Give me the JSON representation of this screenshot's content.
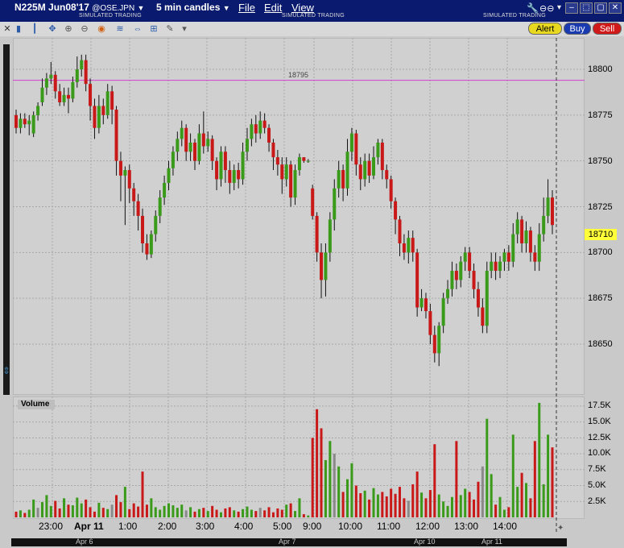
{
  "window": {
    "symbol": "N225M Jun08'17",
    "exchange": "@OSE.JPN",
    "interval": "5 min candles",
    "menu": [
      "File",
      "Edit",
      "View"
    ],
    "simulated_label": "SIMULATED TRADING"
  },
  "toolbar": {
    "alert_label": "Alert",
    "buy_label": "Buy",
    "sell_label": "Sell"
  },
  "colors": {
    "up": "#3a9a1a",
    "down": "#c81818",
    "neutral": "#8a8a8a",
    "hline": "#d040d0",
    "title_bg": "#0a1a6e"
  },
  "price_panel": {
    "current_price": "18710",
    "horizontal_line_label": "18795",
    "price_ticks": [
      "18800",
      "18775",
      "18750",
      "18725",
      "18700",
      "18675",
      "18650"
    ]
  },
  "volume_panel": {
    "title": "Volume",
    "volume_ticks": [
      "17.5K",
      "15.0K",
      "12.5K",
      "10.0K",
      "7.5K",
      "5.0K",
      "2.5K"
    ]
  },
  "time_axis": {
    "labels": [
      "23:00",
      "Apr 11",
      "1:00",
      "2:00",
      "3:00",
      "4:00",
      "5:00",
      "9:00",
      "10:00",
      "11:00",
      "12:00",
      "13:00",
      "14:00"
    ],
    "date_labels": [
      "Apr 6",
      "Apr 7",
      "Apr 10",
      "Apr 11"
    ]
  },
  "chart_data": {
    "type": "candlestick",
    "y_range": [
      18638,
      18815
    ],
    "volume_range": [
      0,
      19000
    ],
    "candles": [
      [
        18775,
        18768,
        18778,
        18765,
        900
      ],
      [
        18768,
        18773,
        18776,
        18765,
        1100
      ],
      [
        18773,
        18770,
        18776,
        18768,
        700
      ],
      [
        18770,
        18772,
        18775,
        18764,
        1200
      ],
      [
        18765,
        18775,
        18777,
        18763,
        2800
      ],
      [
        18775,
        18780,
        18782,
        18772,
        1500
      ],
      [
        18782,
        18790,
        18795,
        18780,
        2400
      ],
      [
        18790,
        18795,
        18798,
        18786,
        3500
      ],
      [
        18795,
        18797,
        18804,
        18792,
        1800
      ],
      [
        18797,
        18788,
        18799,
        18784,
        2600
      ],
      [
        18788,
        18782,
        18792,
        18780,
        1400
      ],
      [
        18782,
        18786,
        18790,
        18780,
        3000
      ],
      [
        18786,
        18784,
        18790,
        18776,
        2000
      ],
      [
        18784,
        18793,
        18796,
        18782,
        1900
      ],
      [
        18793,
        18800,
        18807,
        18790,
        3100
      ],
      [
        18800,
        18805,
        18808,
        18796,
        2200
      ],
      [
        18805,
        18792,
        18808,
        18788,
        2800
      ],
      [
        18792,
        18780,
        18795,
        18772,
        1600
      ],
      [
        18780,
        18768,
        18784,
        18762,
        900
      ],
      [
        18768,
        18780,
        18786,
        18765,
        2300
      ],
      [
        18780,
        18775,
        18784,
        18770,
        1500
      ],
      [
        18775,
        18788,
        18792,
        18773,
        1300
      ],
      [
        18788,
        18778,
        18791,
        18770,
        2000
      ],
      [
        18778,
        18750,
        18780,
        18742,
        3500
      ],
      [
        18750,
        18742,
        18755,
        18728,
        2400
      ],
      [
        18742,
        18745,
        18747,
        18715,
        4800
      ],
      [
        18745,
        18735,
        18748,
        18727,
        1300
      ],
      [
        18735,
        18728,
        18738,
        18720,
        2200
      ],
      [
        18728,
        18720,
        18732,
        18712,
        1700
      ],
      [
        18720,
        18705,
        18724,
        18700,
        7200
      ],
      [
        18705,
        18699,
        18710,
        18696,
        2000
      ],
      [
        18699,
        18710,
        18712,
        18697,
        3000
      ],
      [
        18710,
        18720,
        18723,
        18706,
        1600
      ],
      [
        18720,
        18730,
        18734,
        18716,
        1200
      ],
      [
        18730,
        18738,
        18742,
        18726,
        1800
      ],
      [
        18738,
        18746,
        18750,
        18734,
        2200
      ],
      [
        18746,
        18755,
        18758,
        18742,
        1900
      ],
      [
        18755,
        18762,
        18766,
        18750,
        1500
      ],
      [
        18762,
        18768,
        18772,
        18758,
        2000
      ],
      [
        18768,
        18755,
        18770,
        18750,
        1100
      ],
      [
        18755,
        18760,
        18765,
        18750,
        1600
      ],
      [
        18760,
        18750,
        18762,
        18745,
        900
      ],
      [
        18750,
        18765,
        18770,
        18748,
        1300
      ],
      [
        18765,
        18758,
        18777,
        18754,
        1500
      ],
      [
        18758,
        18762,
        18766,
        18755,
        1000
      ],
      [
        18762,
        18750,
        18764,
        18745,
        1800
      ],
      [
        18750,
        18740,
        18752,
        18734,
        1200
      ],
      [
        18740,
        18755,
        18758,
        18736,
        800
      ],
      [
        18755,
        18745,
        18758,
        18738,
        1400
      ],
      [
        18745,
        18738,
        18750,
        18732,
        1600
      ],
      [
        18738,
        18745,
        18748,
        18734,
        1100
      ],
      [
        18745,
        18740,
        18749,
        18735,
        900
      ],
      [
        18740,
        18755,
        18760,
        18737,
        1300
      ],
      [
        18755,
        18762,
        18768,
        18750,
        1700
      ],
      [
        18762,
        18770,
        18773,
        18758,
        1200
      ],
      [
        18770,
        18765,
        18775,
        18760,
        1000
      ],
      [
        18765,
        18772,
        18777,
        18762,
        1500
      ],
      [
        18772,
        18768,
        18776,
        18765,
        1100
      ],
      [
        18768,
        18760,
        18770,
        18755,
        1600
      ],
      [
        18760,
        18752,
        18762,
        18745,
        800
      ],
      [
        18752,
        18748,
        18756,
        18742,
        1400
      ],
      [
        18748,
        18740,
        18752,
        18732,
        1200
      ],
      [
        18740,
        18748,
        18752,
        18736,
        2000
      ],
      [
        18748,
        18730,
        18750,
        18725,
        2200
      ],
      [
        18730,
        18745,
        18748,
        18726,
        1000
      ],
      [
        18745,
        18752,
        18754,
        18742,
        3000
      ],
      [
        18752,
        18750,
        18752,
        18749,
        500
      ],
      [
        18750,
        18750,
        18751,
        18749,
        300
      ],
      [
        18735,
        18720,
        18737,
        18718,
        12500
      ],
      [
        18720,
        18700,
        18722,
        18695,
        17000
      ],
      [
        18700,
        18685,
        18705,
        18675,
        14000
      ],
      [
        18685,
        18700,
        18705,
        18676,
        9000
      ],
      [
        18700,
        18718,
        18722,
        18695,
        12000
      ],
      [
        18718,
        18735,
        18740,
        18712,
        10000
      ],
      [
        18735,
        18745,
        18750,
        18730,
        8000
      ],
      [
        18745,
        18735,
        18748,
        18728,
        4000
      ],
      [
        18735,
        18755,
        18762,
        18731,
        6000
      ],
      [
        18755,
        18765,
        18768,
        18750,
        8500
      ],
      [
        18765,
        18748,
        18767,
        18742,
        5000
      ],
      [
        18748,
        18740,
        18752,
        18734,
        3800
      ],
      [
        18740,
        18750,
        18754,
        18736,
        4200
      ],
      [
        18750,
        18742,
        18754,
        18738,
        2800
      ],
      [
        18742,
        18752,
        18758,
        18740,
        4600
      ],
      [
        18752,
        18760,
        18762,
        18748,
        3600
      ],
      [
        18760,
        18745,
        18762,
        18740,
        4000
      ],
      [
        18745,
        18740,
        18748,
        18735,
        3300
      ],
      [
        18740,
        18728,
        18742,
        18724,
        4500
      ],
      [
        18728,
        18718,
        18730,
        18710,
        3700
      ],
      [
        18718,
        18705,
        18720,
        18698,
        4800
      ],
      [
        18705,
        18700,
        18710,
        18696,
        3000
      ],
      [
        18700,
        18708,
        18712,
        18694,
        2600
      ],
      [
        18708,
        18700,
        18712,
        18695,
        5200
      ],
      [
        18700,
        18670,
        18702,
        18665,
        7200
      ],
      [
        18670,
        18675,
        18680,
        18668,
        3900
      ],
      [
        18675,
        18668,
        18678,
        18664,
        3000
      ],
      [
        18668,
        18655,
        18672,
        18650,
        4300
      ],
      [
        18655,
        18645,
        18660,
        18640,
        11500
      ],
      [
        18645,
        18660,
        18662,
        18638,
        3600
      ],
      [
        18660,
        18675,
        18678,
        18656,
        2500
      ],
      [
        18675,
        18680,
        18685,
        18672,
        1800
      ],
      [
        18680,
        18690,
        18695,
        18676,
        3200
      ],
      [
        18690,
        18685,
        18694,
        18680,
        12000
      ],
      [
        18685,
        18695,
        18698,
        18681,
        3500
      ],
      [
        18695,
        18700,
        18703,
        18690,
        4500
      ],
      [
        18700,
        18690,
        18703,
        18686,
        4000
      ],
      [
        18690,
        18680,
        18694,
        18675,
        2800
      ],
      [
        18680,
        18670,
        18684,
        18665,
        5600
      ],
      [
        18670,
        18660,
        18675,
        18656,
        8000
      ],
      [
        18660,
        18690,
        18695,
        18656,
        15500
      ],
      [
        18690,
        18695,
        18700,
        18686,
        6800
      ],
      [
        18695,
        18690,
        18700,
        18685,
        2000
      ],
      [
        18690,
        18695,
        18698,
        18686,
        3200
      ],
      [
        18695,
        18700,
        18702,
        18690,
        1200
      ],
      [
        18700,
        18695,
        18704,
        18690,
        1600
      ],
      [
        18695,
        18710,
        18716,
        18692,
        13000
      ],
      [
        18710,
        18718,
        18722,
        18705,
        4800
      ],
      [
        18718,
        18705,
        18720,
        18700,
        7000
      ],
      [
        18705,
        18712,
        18717,
        18700,
        5400
      ],
      [
        18712,
        18700,
        18714,
        18695,
        3000
      ],
      [
        18700,
        18695,
        18704,
        18690,
        12000
      ],
      [
        18695,
        18710,
        18716,
        18690,
        18000
      ],
      [
        18710,
        18720,
        18730,
        18706,
        5200
      ],
      [
        18720,
        18730,
        18740,
        18716,
        13000
      ],
      [
        18730,
        18715,
        18734,
        18710,
        11000
      ]
    ]
  }
}
